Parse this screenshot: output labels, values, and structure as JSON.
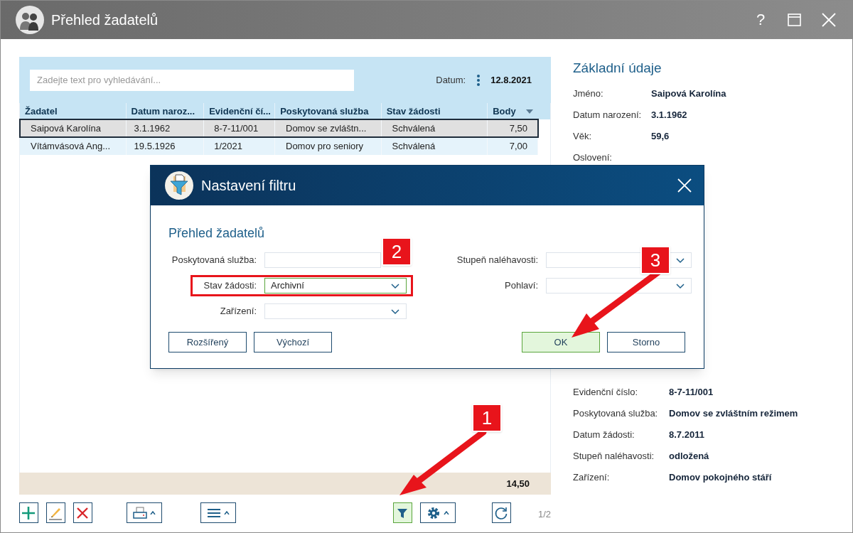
{
  "window": {
    "title": "Přehled žadatelů",
    "buttons": [
      {
        "kind": "help",
        "label": "?"
      },
      {
        "kind": "maximize"
      },
      {
        "kind": "close"
      }
    ]
  },
  "search": {
    "placeholder": "Zadejte text pro vyhledávání..."
  },
  "date": {
    "label": "Datum:",
    "value": "12.8.2021"
  },
  "table": {
    "columns": [
      {
        "label": "Žadatel"
      },
      {
        "label": "Datum naroz..."
      },
      {
        "label": "Evidenční čí..."
      },
      {
        "label": "Poskytovaná služba"
      },
      {
        "label": "Stav žádosti"
      },
      {
        "label": "Body",
        "sorted": true
      }
    ],
    "rows": [
      {
        "selected": true,
        "cells": [
          "Saipová Karolína",
          "3.1.1962",
          "8-7-11/001",
          "Domov se zvláštn...",
          "Schválená",
          "7,50"
        ]
      },
      {
        "selected": false,
        "cells": [
          "Vítámvásová Ang...",
          "19.5.1926",
          "1/2021",
          "Domov pro seniory",
          "Schválená",
          "7,00"
        ]
      }
    ],
    "total": "14,50"
  },
  "toolbar": [
    {
      "kind": "add",
      "active": false
    },
    {
      "kind": "edit",
      "active": false
    },
    {
      "kind": "delete",
      "active": false
    },
    {
      "kind": "print",
      "active": false
    },
    {
      "kind": "menu",
      "active": false
    },
    {
      "kind": "filter",
      "active": true
    },
    {
      "kind": "settings",
      "active": false
    },
    {
      "kind": "refresh",
      "active": false
    }
  ],
  "page": "1/2",
  "details": {
    "title": "Základní údaje",
    "fields": [
      {
        "label": "Jméno:",
        "value": "Saipová Karolína"
      },
      {
        "label": "Datum narození:",
        "value": "3.1.1962"
      },
      {
        "label": "Věk:",
        "value": "59,6"
      },
      {
        "label": "Oslovení:"
      }
    ]
  },
  "request_details": {
    "fields": [
      {
        "label": "Evidenční číslo:",
        "value": "8-7-11/001"
      },
      {
        "label": "Poskytovaná služba:",
        "value": "Domov se zvláštním režimem"
      },
      {
        "label": "Datum žádosti:",
        "value": "8.7.2011"
      },
      {
        "label": "Stupeň naléhavosti:",
        "value": "odložená"
      },
      {
        "label": "Zařízení:",
        "value": "Domov pokojného stáří"
      }
    ]
  },
  "dialog": {
    "title": "Nastavení filtru",
    "heading": "Přehled žadatelů",
    "left_fields": [
      {
        "label": "Poskytovaná služba:",
        "kind": "text",
        "focused": false
      },
      {
        "label": "Stav žádosti:",
        "kind": "dropdown",
        "value": "Archivní",
        "focused": true,
        "highlighted": true
      },
      {
        "label": "Zařízení:",
        "kind": "dropdown",
        "focused": false
      }
    ],
    "right_fields": [
      {
        "label": "Stupeň naléhavosti:",
        "kind": "dropdown",
        "focused": false
      },
      {
        "label": "Pohlaví:",
        "kind": "dropdown",
        "focused": false
      }
    ],
    "left_buttons": [
      {
        "label": "Rozšířený",
        "default": false
      },
      {
        "label": "Výchozí",
        "default": false
      }
    ],
    "right_buttons": [
      {
        "label": "OK",
        "default": true
      },
      {
        "label": "Storno",
        "default": false
      }
    ]
  },
  "annotations": [
    {
      "label": "1"
    },
    {
      "label": "2"
    },
    {
      "label": "3"
    }
  ]
}
